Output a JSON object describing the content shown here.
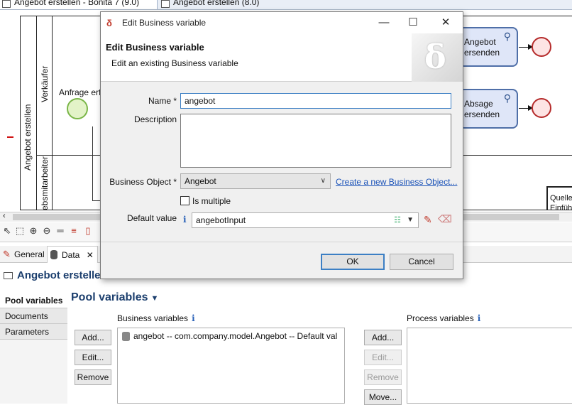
{
  "editor_tabs": [
    "Angebot erstellen - Bonita 7 (9.0)",
    "Angebot erstellen (8.0)"
  ],
  "diagram": {
    "pool_name": "Angebot erstellen",
    "lane1": "Verkäufer",
    "lane2": "Vertriebsmitarbeiter",
    "lane2_visible": "ebsmitarbeiter",
    "start_event_label": "Anfrage erf",
    "task1_line1": "Angebot",
    "task1_line2": "ersenden",
    "task2_line1": "Absage",
    "task2_line2": "ersenden",
    "annotation_line1": "Quelle",
    "annotation_line2": "Einfüh"
  },
  "properties": {
    "tabs": [
      "General",
      "Data"
    ],
    "title": "Angebot erstellen",
    "nav": [
      "Pool variables",
      "Documents",
      "Parameters"
    ],
    "section_title": "Pool variables",
    "business_vars_label": "Business variables",
    "process_vars_label": "Process variables",
    "business_vars": [
      "angebot -- com.company.model.Angebot -- Default val"
    ],
    "left_buttons": [
      "Add...",
      "Edit...",
      "Remove"
    ],
    "right_buttons": [
      "Add...",
      "Edit...",
      "Remove",
      "Move..."
    ]
  },
  "dialog": {
    "window_title": "Edit Business variable",
    "header_title": "Edit Business variable",
    "header_subtitle": "Edit an existing Business variable",
    "name_label": "Name *",
    "name_value": "angebot",
    "description_label": "Description",
    "description_value": "",
    "business_object_label": "Business Object *",
    "business_object_value": "Angebot",
    "create_link": "Create a new Business Object...",
    "is_multiple_label": "Is multiple",
    "default_value_label": "Default value",
    "default_value": "angebotInput",
    "ok": "OK",
    "cancel": "Cancel"
  }
}
